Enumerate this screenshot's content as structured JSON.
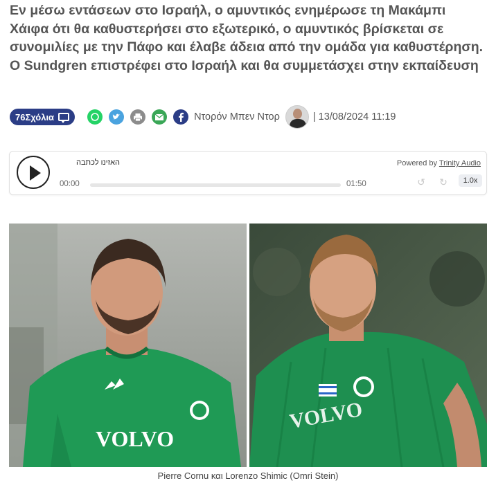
{
  "article": {
    "headline": "Εν μέσω εντάσεων στο Ισραήλ, ο αμυντικός ενημέρωσε τη Μακάμπι Χάιφα ότι θα καθυστερήσει στο εξωτερικό, ο αμυντικός βρίσκεται σε συνομιλίες με την Πάφο και έλαβε άδεια από την ομάδα για καθυστέρηση. Ο Sundgren επιστρέφει στο Ισραήλ και θα συμμετάσχει στην εκπαίδευση",
    "comments_label": "76Σχόλια",
    "author": "Ντορόν Μπεν Ντορ",
    "date": "| 13/08/2024 11:19",
    "caption": "Pierre Cornu και Lorenzo Shimic (Omri Stein)"
  },
  "share_icons": [
    {
      "name": "whatsapp-icon",
      "color": "#25d366"
    },
    {
      "name": "twitter-icon",
      "color": "#4aa3df"
    },
    {
      "name": "print-icon",
      "color": "#8c8c8c"
    },
    {
      "name": "email-icon",
      "color": "#3aa757"
    },
    {
      "name": "facebook-icon",
      "color": "#2b3d86"
    }
  ],
  "audio": {
    "listen_label": "האזינו לכתבה",
    "time_current": "00:00",
    "time_total": "01:50",
    "powered_by": "Powered by",
    "powered_link": "Trinity Audio",
    "speed": "1.0x",
    "progress": 0
  },
  "photos": {
    "left_jersey_text": "VOLVO",
    "right_jersey_text": "VOLVO"
  },
  "colors": {
    "comments_badge": "#2b3d86",
    "jersey_green": "#1f9a55",
    "headline_text": "#555555"
  }
}
